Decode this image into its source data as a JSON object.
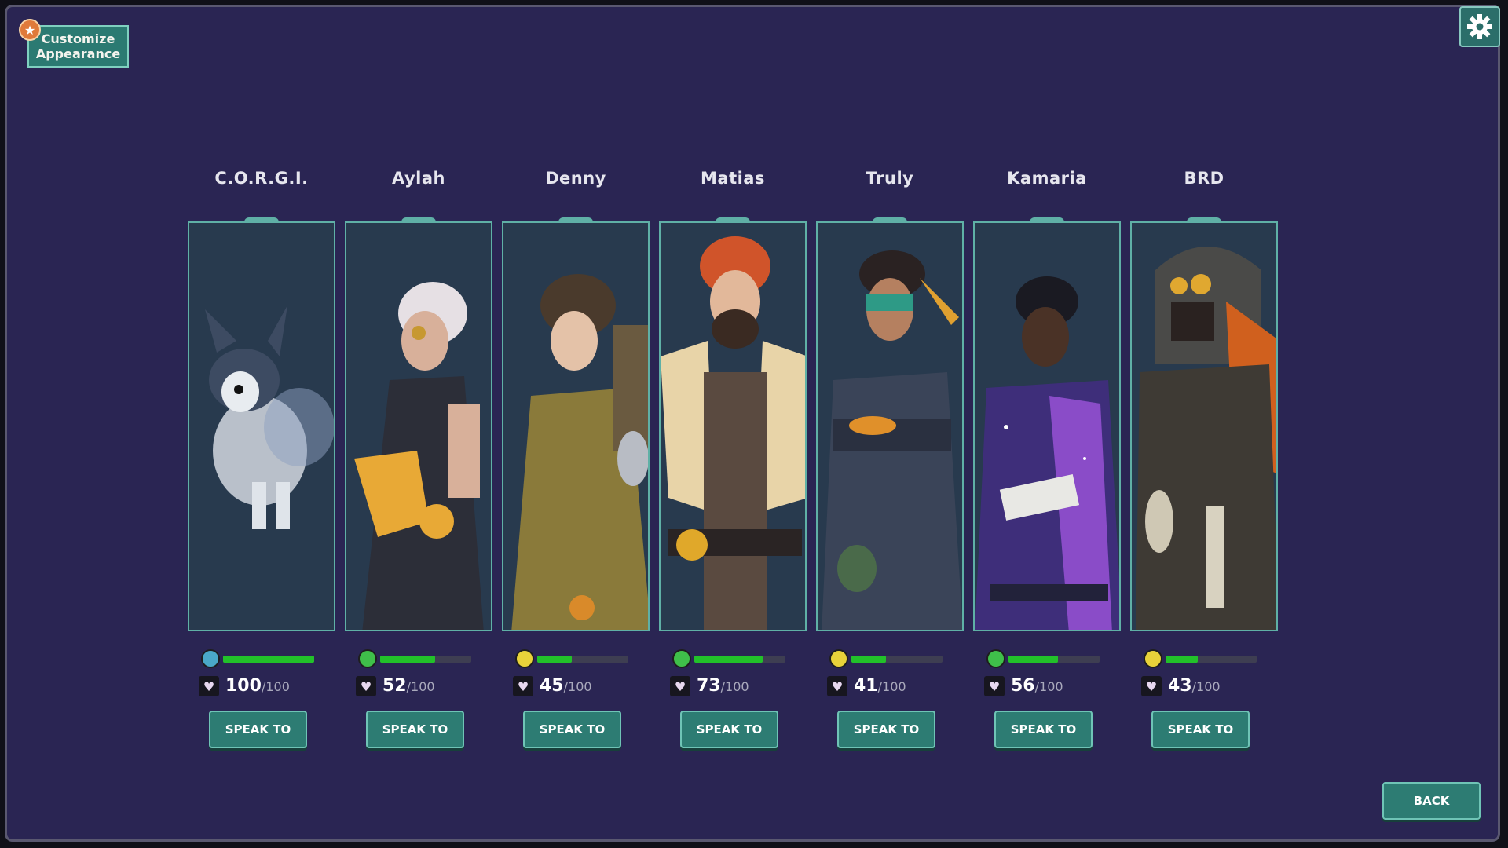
{
  "customize": {
    "label": "Customize Appearance"
  },
  "settings": {
    "icon": "gear-icon"
  },
  "back": {
    "label": "BACK"
  },
  "colors": {
    "background": "#2a2553",
    "accent": "#2d7c73",
    "mood_fill": "#22c12a"
  },
  "characters": [
    {
      "name": "C.O.R.G.I.",
      "mood": "happy",
      "mood_color": "#4aa8c8",
      "mood_level": 1.0,
      "affinity": "100",
      "affinity_max": "/100",
      "speak_label": "SPEAK TO"
    },
    {
      "name": "Aylah",
      "mood": "happy",
      "mood_color": "#3fbf4a",
      "mood_level": 0.6,
      "affinity": "52",
      "affinity_max": "/100",
      "speak_label": "SPEAK TO"
    },
    {
      "name": "Denny",
      "mood": "neutral",
      "mood_color": "#e8d23a",
      "mood_level": 0.38,
      "affinity": "45",
      "affinity_max": "/100",
      "speak_label": "SPEAK TO"
    },
    {
      "name": "Matias",
      "mood": "happy",
      "mood_color": "#3fbf4a",
      "mood_level": 0.75,
      "affinity": "73",
      "affinity_max": "/100",
      "speak_label": "SPEAK TO"
    },
    {
      "name": "Truly",
      "mood": "neutral",
      "mood_color": "#e8d23a",
      "mood_level": 0.38,
      "affinity": "41",
      "affinity_max": "/100",
      "speak_label": "SPEAK TO"
    },
    {
      "name": "Kamaria",
      "mood": "happy",
      "mood_color": "#3fbf4a",
      "mood_level": 0.54,
      "affinity": "56",
      "affinity_max": "/100",
      "speak_label": "SPEAK TO"
    },
    {
      "name": "BRD",
      "mood": "neutral",
      "mood_color": "#e8d23a",
      "mood_level": 0.35,
      "affinity": "43",
      "affinity_max": "/100",
      "speak_label": "SPEAK TO"
    }
  ]
}
